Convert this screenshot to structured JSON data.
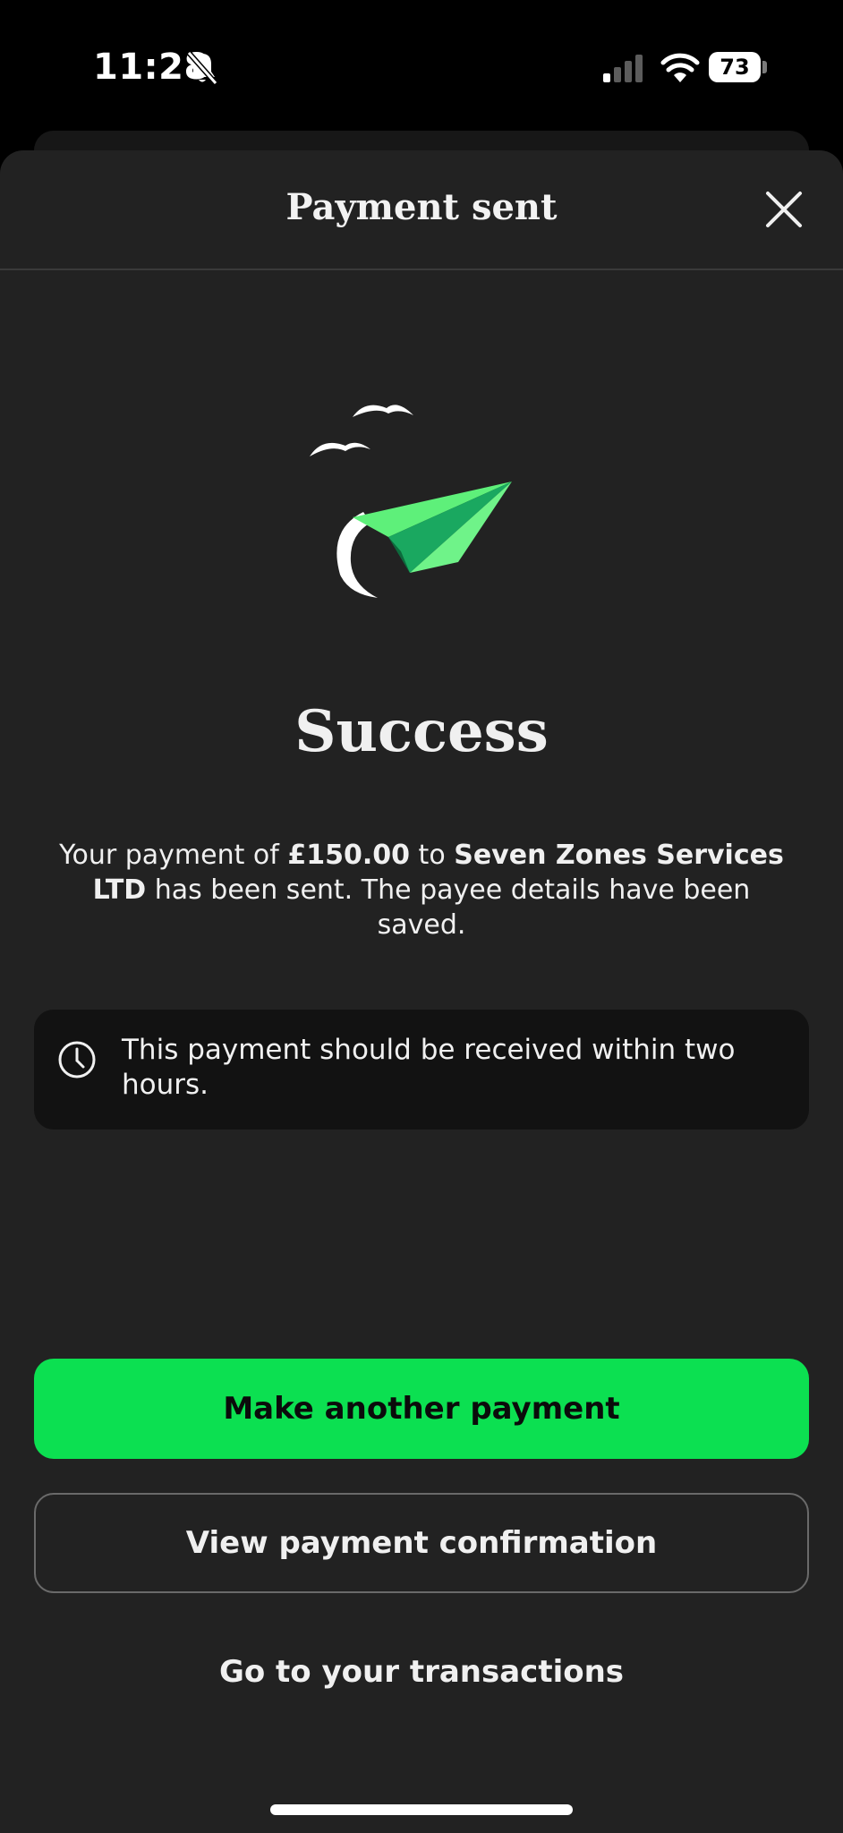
{
  "status_bar": {
    "time": "11:28",
    "battery": "73",
    "icons": [
      "bell-slash-icon",
      "signal-icon",
      "wifi-icon",
      "battery-icon"
    ]
  },
  "header": {
    "title": "Payment sent",
    "close_icon": "close-icon"
  },
  "illustration": "paper-plane-with-birds",
  "main": {
    "title": "Success",
    "message": {
      "part1": "Your payment of ",
      "amount": "£150.00",
      "part2": " to ",
      "payee": "Seven Zones Services LTD",
      "part3": " has been sent. The payee details have been saved."
    },
    "info": {
      "icon": "clock-icon",
      "text": "This payment should be received within two hours."
    }
  },
  "actions": {
    "primary": "Make another payment",
    "secondary": "View payment confirmation",
    "link": "Go to your transactions"
  },
  "colors": {
    "accent": "#0ce051",
    "sheet_bg": "#222222",
    "info_bg": "#121212",
    "plane_light": "#5ef07a",
    "plane_dark": "#14a058"
  }
}
